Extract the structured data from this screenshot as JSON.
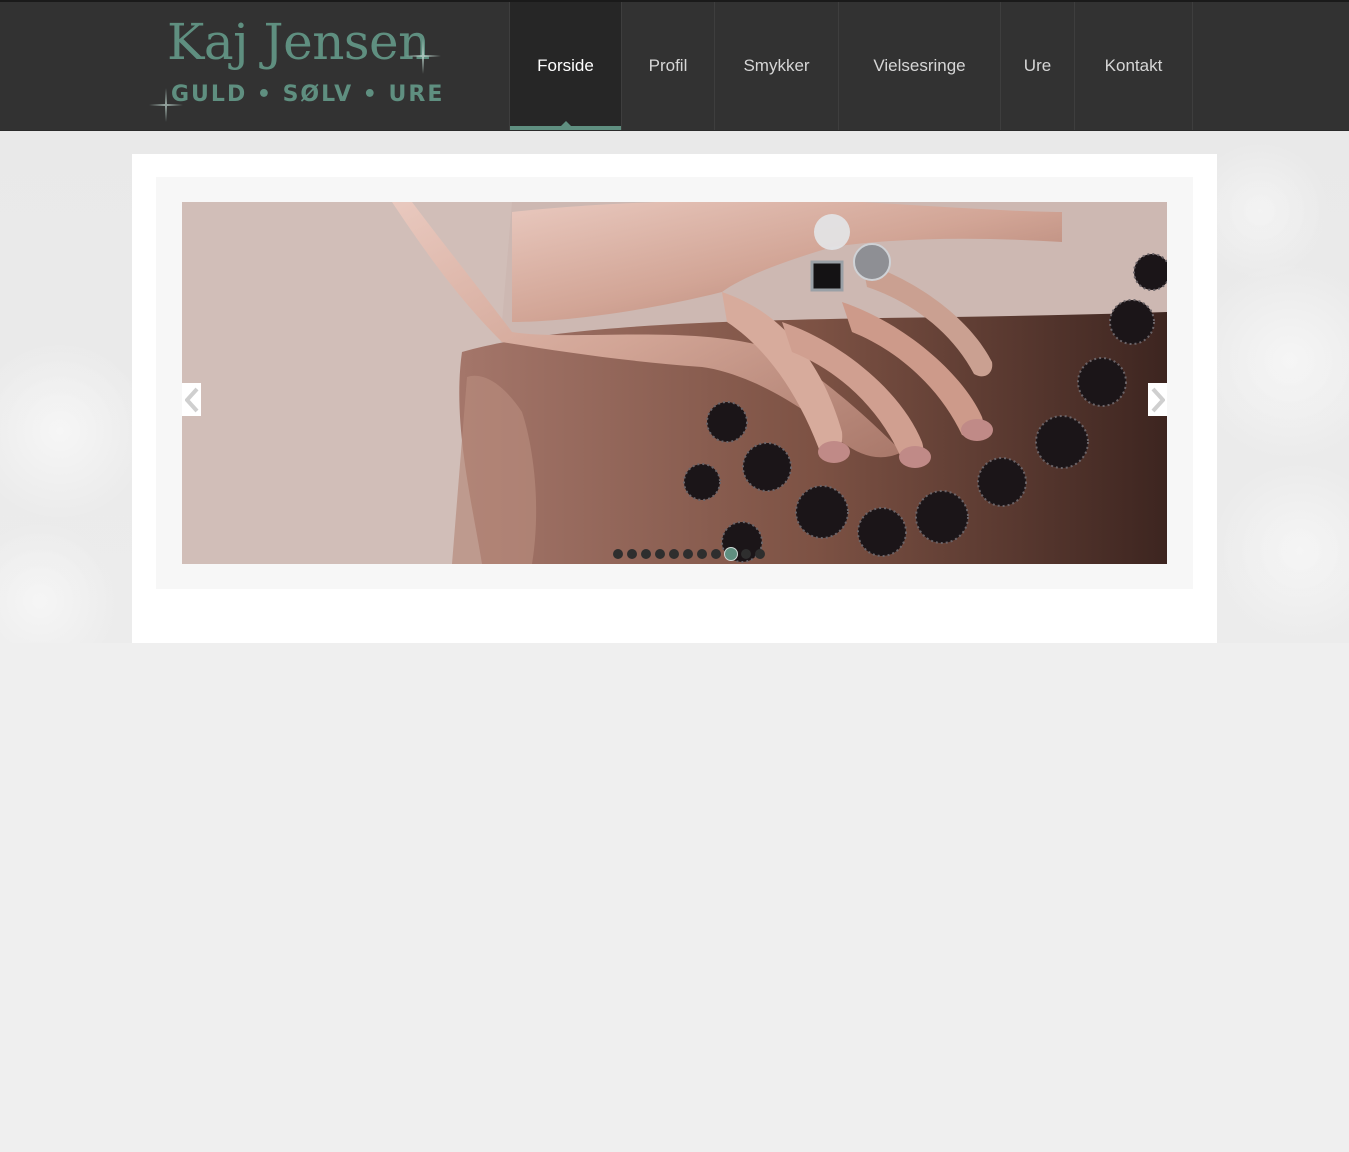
{
  "brand": {
    "name": "Kaj Jensen",
    "tagline": "GULD • SØLV • URE",
    "color": "#5f8f80"
  },
  "nav": {
    "items": [
      {
        "label": "Forside",
        "active": true
      },
      {
        "label": "Profil",
        "active": false
      },
      {
        "label": "Smykker",
        "active": false
      },
      {
        "label": "Vielsesringe",
        "active": false
      },
      {
        "label": "Ure",
        "active": false
      },
      {
        "label": "Kontakt",
        "active": false
      }
    ]
  },
  "slider": {
    "image_subject": "hand-with-ring-and-necklace",
    "prev_icon": "chevron-left-icon",
    "next_icon": "chevron-right-icon",
    "slide_count": 11,
    "active_index": 8
  },
  "colors": {
    "header_bg": "#323232",
    "page_bg": "#efefef",
    "accent": "#5f8f80"
  }
}
